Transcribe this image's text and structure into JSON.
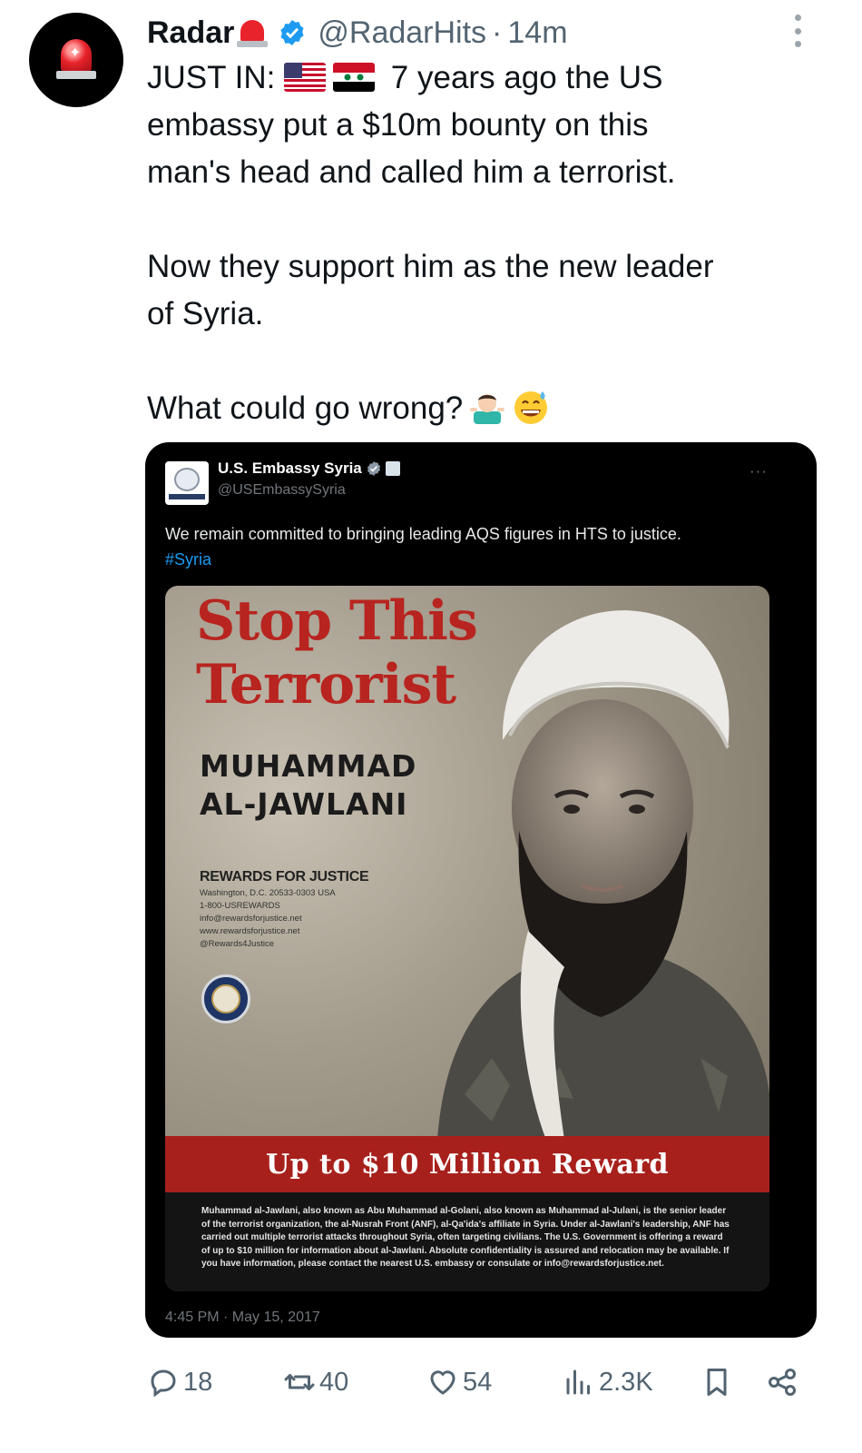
{
  "author": {
    "name": "Radar",
    "handle": "@RadarHits",
    "separator": "·",
    "time": "14m",
    "avatar_icon": "siren-icon",
    "verified_color": "#1d9bf0"
  },
  "tweet": {
    "lines": [
      {
        "prefix": "JUST IN:",
        "suffix": "7 years ago the US"
      },
      "embassy put a $10m bounty on this",
      "man's head and called him a terrorist.",
      "Now they support him as the new leader",
      "of Syria.",
      "What could go wrong?"
    ],
    "emojis": [
      "us-flag-icon",
      "syria-flag-icon",
      "person-shrugging-icon",
      "grinning-sweat-icon"
    ]
  },
  "quoted": {
    "name": "U.S. Embassy Syria",
    "handle": "@USEmbassySyria",
    "text": "We remain committed to bringing leading AQS figures in HTS to justice.",
    "hashtag": "#Syria",
    "timestamp": "4:45 PM · May 15, 2017",
    "poster": {
      "headline_1": "Stop This",
      "headline_2": "Terrorist",
      "name_1": "MUHAMMAD",
      "name_2": "AL-JAWLANI",
      "rfj_title": "REWARDS FOR JUSTICE",
      "rfj_lines": [
        "Washington, D.C. 20533-0303 USA",
        "1-800-USREWARDS",
        "info@rewardsforjustice.net",
        "www.rewardsforjustice.net",
        "@Rewards4Justice"
      ],
      "reward_banner": "Up to $10 Million Reward",
      "fine_print": "Muhammad al-Jawlani, also known as Abu Muhammad al-Golani, also known as Muhammad al-Julani, is the senior leader of the terrorist organization, the al-Nusrah Front (ANF), al-Qa'ida's affiliate in Syria. Under al-Jawlani's leadership, ANF has carried out multiple terrorist attacks throughout Syria, often targeting civilians. The U.S. Government is offering a reward of up to $10 million for information about al-Jawlani. Absolute confidentiality is assured and relocation may be available. If you have information, please contact the nearest U.S. embassy or consulate or info@rewardsforjustice.net.",
      "headline_color": "#b8241f",
      "banner_color": "#a8201c"
    }
  },
  "actions": {
    "replies": "18",
    "reposts": "40",
    "likes": "54",
    "views": "2.3K",
    "icons": [
      "reply-icon",
      "repost-icon",
      "like-icon",
      "views-icon",
      "bookmark-icon",
      "share-icon"
    ]
  },
  "colors": {
    "text": "#0f1419",
    "muted": "#536471",
    "card_bg": "#000000",
    "link": "#1d9bf0"
  }
}
